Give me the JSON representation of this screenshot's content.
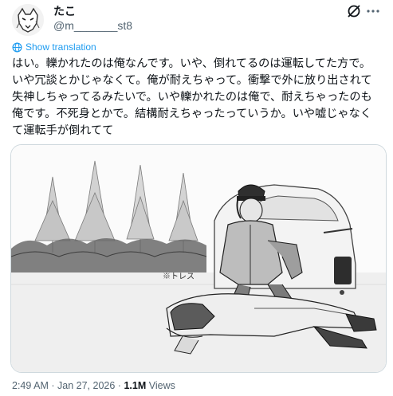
{
  "author": {
    "display_name": "たこ",
    "handle": "@m_______st8",
    "avatar_icon": "wolf-avatar-icon"
  },
  "actions": {
    "grok_icon": "grok-icon",
    "more_icon": "more-dots-icon"
  },
  "translate": {
    "label": "Show translation",
    "icon": "globe-icon",
    "color": "#1d9bf0"
  },
  "tweet": {
    "text": "はい。轢かれたのは俺なんです。いや、倒れてるのは運転してた方で。いや冗談とかじゃなくて。俺が耐えちゃって。衝撃で外に放り出されて失神しちゃってるみたいで。いや轢かれたのは俺で、耐えちゃったのも俺です。不死身とかで。結構耐えちゃったっていうか。いや嘘じゃなくて運転手が倒れてて"
  },
  "media": {
    "kind": "manga-style illustration",
    "signature": "※トレス"
  },
  "meta": {
    "time": "2:49 AM",
    "separator": "·",
    "date": "Jan 27, 2026",
    "views_count": "1.1M",
    "views_label": "Views"
  },
  "colors": {
    "text": "#0f1419",
    "secondary": "#536471",
    "border": "#cfd9de"
  }
}
